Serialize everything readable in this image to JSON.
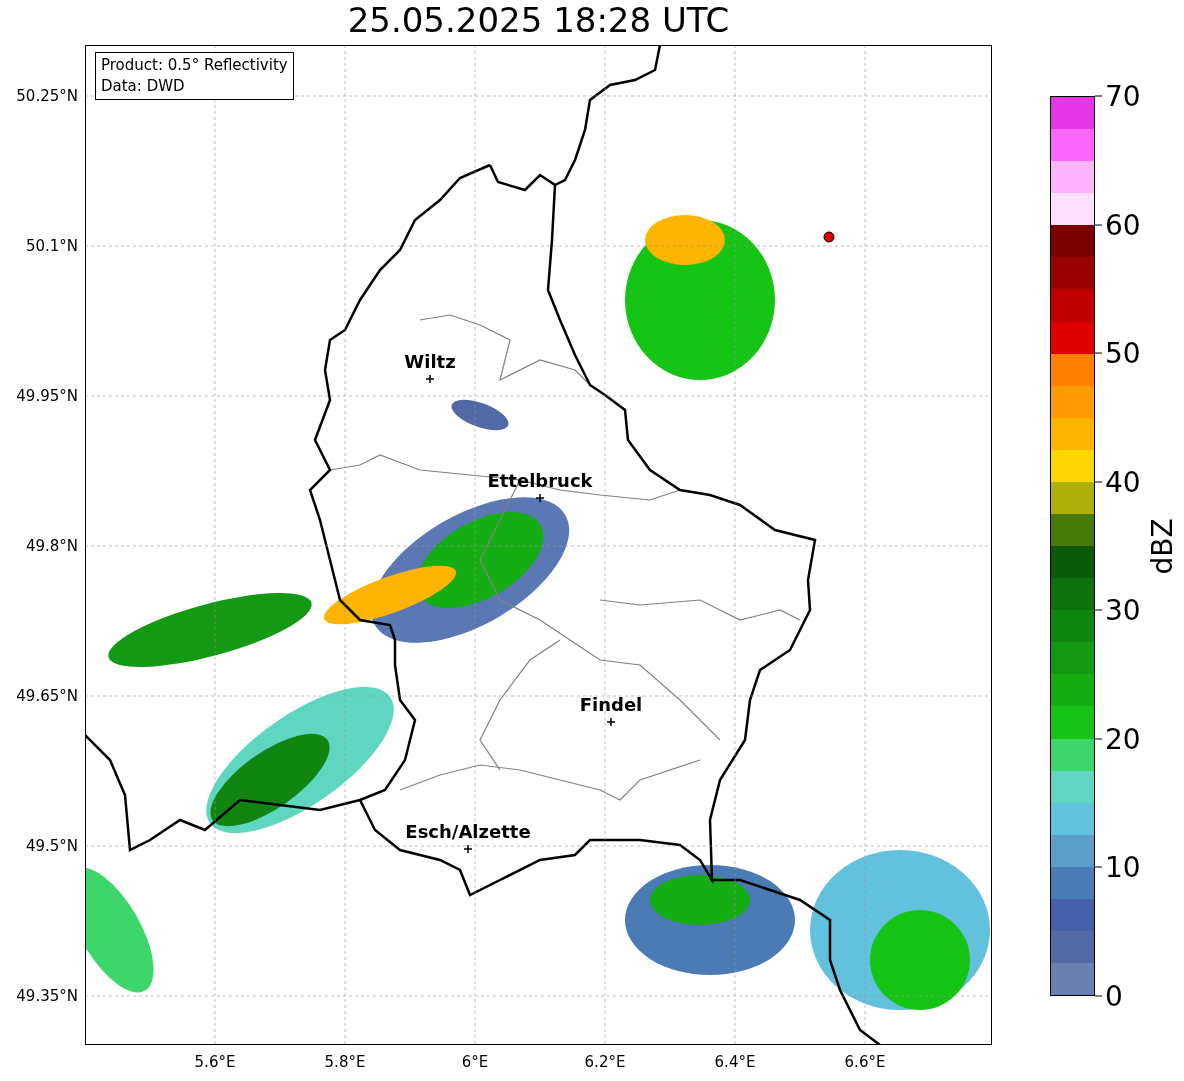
{
  "title": "25.05.2025 18:28 UTC",
  "info_box": [
    "Product: 0.5° Reflectivity",
    "Data: DWD"
  ],
  "y_ticks": [
    "50.25°N",
    "50.1°N",
    "49.95°N",
    "49.8°N",
    "49.65°N",
    "49.5°N",
    "49.35°N"
  ],
  "x_ticks": [
    "5.6°E",
    "5.8°E",
    "6°E",
    "6.2°E",
    "6.4°E",
    "6.6°E"
  ],
  "cities": [
    {
      "name": "Wiltz"
    },
    {
      "name": "Ettelbruck"
    },
    {
      "name": "Findel"
    },
    {
      "name": "Esch/Alzette"
    }
  ],
  "colorbar": {
    "label": "dBZ",
    "ticks": [
      "70",
      "60",
      "50",
      "40",
      "30",
      "20",
      "10",
      "0"
    ],
    "bins": [
      {
        "color": "#e535e8"
      },
      {
        "color": "#fb66fb"
      },
      {
        "color": "#fdb3fd"
      },
      {
        "color": "#fde0fd"
      },
      {
        "color": "#7a0000"
      },
      {
        "color": "#9b0000"
      },
      {
        "color": "#c00000"
      },
      {
        "color": "#e00000"
      },
      {
        "color": "#ff7f00"
      },
      {
        "color": "#ff9a00"
      },
      {
        "color": "#ffb400"
      },
      {
        "color": "#ffd700"
      },
      {
        "color": "#adb00a"
      },
      {
        "color": "#477a0b"
      },
      {
        "color": "#0a5a0a"
      },
      {
        "color": "#0d720d"
      },
      {
        "color": "#108510"
      },
      {
        "color": "#139913"
      },
      {
        "color": "#14ad14"
      },
      {
        "color": "#16c416"
      },
      {
        "color": "#3ed66b"
      },
      {
        "color": "#5ed6c0"
      },
      {
        "color": "#62c1dc"
      },
      {
        "color": "#5b9ec8"
      },
      {
        "color": "#4a7bb4"
      },
      {
        "color": "#4360a8"
      },
      {
        "color": "#5269a5"
      },
      {
        "color": "#6b7fb0"
      }
    ]
  }
}
